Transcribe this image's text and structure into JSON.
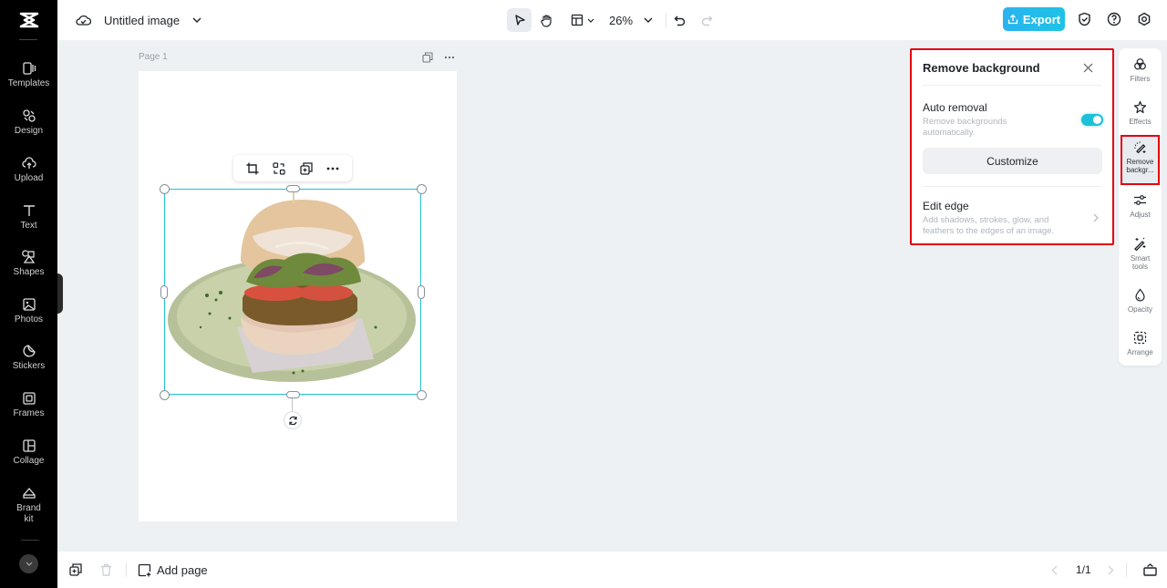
{
  "app": {
    "document_title": "Untitled image"
  },
  "sidebar": {
    "items": [
      {
        "label": "Templates",
        "icon": "templates-icon"
      },
      {
        "label": "Design",
        "icon": "design-icon"
      },
      {
        "label": "Upload",
        "icon": "upload-icon"
      },
      {
        "label": "Text",
        "icon": "text-icon"
      },
      {
        "label": "Shapes",
        "icon": "shapes-icon"
      },
      {
        "label": "Photos",
        "icon": "photos-icon"
      },
      {
        "label": "Stickers",
        "icon": "stickers-icon"
      },
      {
        "label": "Frames",
        "icon": "frames-icon"
      },
      {
        "label": "Collage",
        "icon": "collage-icon"
      },
      {
        "label": "Brand kit",
        "icon": "brand-kit-icon"
      }
    ]
  },
  "toolbar": {
    "zoom_level": "26%",
    "export_label": "Export"
  },
  "canvas": {
    "page_label": "Page 1",
    "image_alt": "Veggie burger on a green plate"
  },
  "remove_bg_panel": {
    "title": "Remove background",
    "auto_removal": {
      "title": "Auto removal",
      "description": "Remove backgrounds automatically.",
      "enabled": true
    },
    "customize_label": "Customize",
    "edit_edge": {
      "title": "Edit edge",
      "description": "Add shadows, strokes, glow, and feathers to the edges of an image."
    }
  },
  "tools_rail": {
    "items": [
      {
        "label": "Filters"
      },
      {
        "label": "Effects"
      },
      {
        "label": "Remove backgr...",
        "active": true
      },
      {
        "label": "Adjust"
      },
      {
        "label": "Smart tools"
      },
      {
        "label": "Opacity"
      },
      {
        "label": "Arrange"
      }
    ]
  },
  "bottombar": {
    "add_page_label": "Add page",
    "page_indicator": "1/1"
  },
  "colors": {
    "accent": "#1ec0d8",
    "export_button": "#22b8ea",
    "highlight_border": "#e3000f",
    "sidebar_bg": "#000000",
    "canvas_bg": "#eef1f4"
  }
}
